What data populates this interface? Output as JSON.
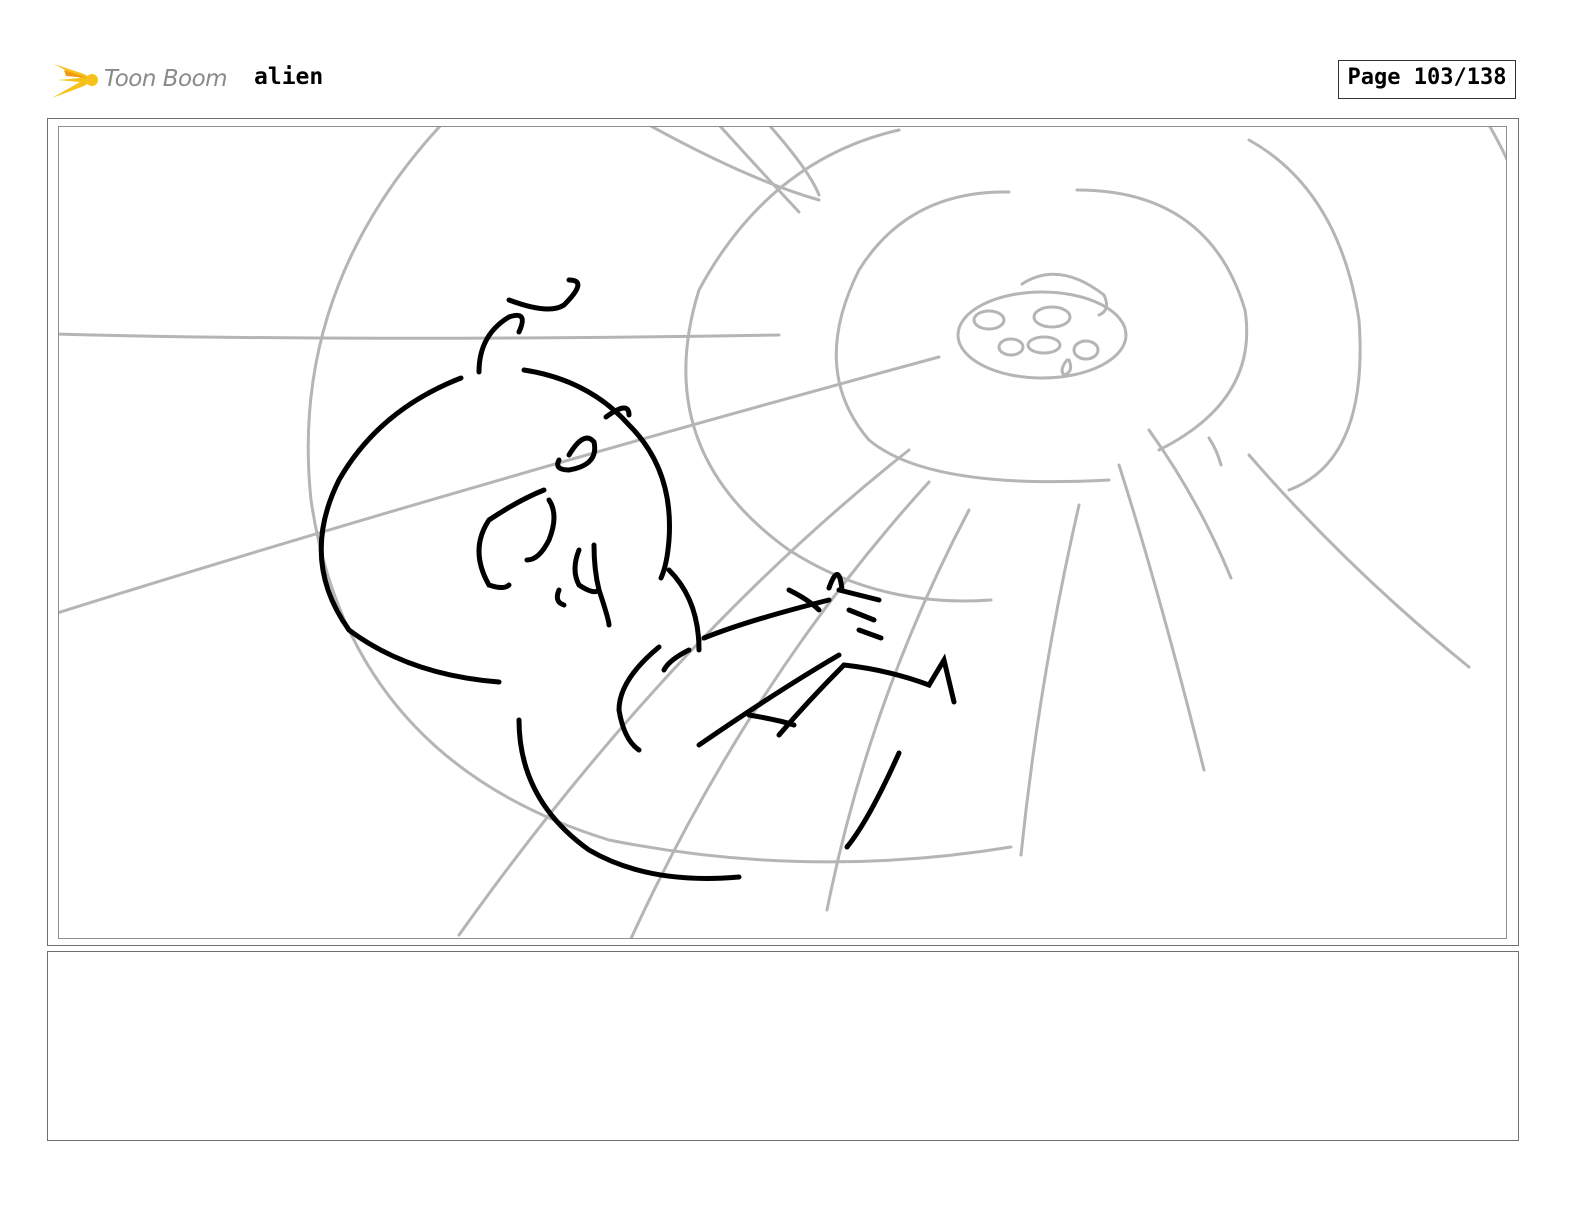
{
  "header": {
    "brand": "Toon Boom",
    "project_title": "alien",
    "page_label": "Page 103/138"
  },
  "panel": {
    "description_icon": "storyboard-sketch"
  },
  "notes": {
    "text": ""
  },
  "colors": {
    "logo_yellow": "#f6c21a",
    "logo_orange": "#f39a12",
    "sketch_gray": "#b5b5b5",
    "ink_black": "#000000"
  }
}
